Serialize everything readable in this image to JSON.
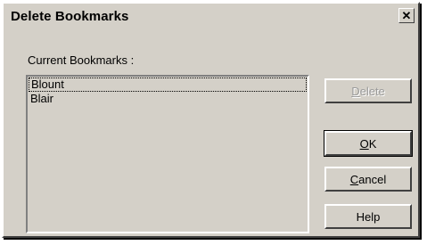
{
  "dialog": {
    "title": "Delete Bookmarks",
    "close_glyph": "✕",
    "close_icon": "close-icon"
  },
  "bookmarks": {
    "label": "Current Bookmarks :",
    "items": [
      "Blount",
      "Blair"
    ]
  },
  "buttons": {
    "delete": "Delete",
    "ok": "OK",
    "cancel": "Cancel",
    "help": "Help"
  }
}
